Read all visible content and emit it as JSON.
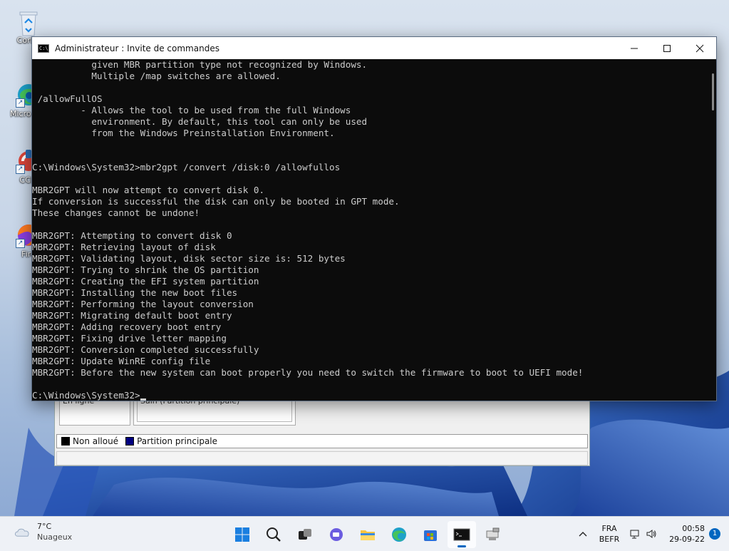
{
  "desktop": {
    "icons": [
      {
        "label": "Corbe",
        "icon": "recycle-bin-icon"
      },
      {
        "label": "Micro Edg",
        "icon": "edge-icon"
      },
      {
        "label": "CCle",
        "icon": "ccleaner-icon"
      },
      {
        "label": "Fire",
        "icon": "firefox-icon"
      }
    ]
  },
  "disk_management": {
    "disk_label": "En ligne",
    "partition_label": "Sain (Partition principale)",
    "legend": [
      {
        "label": "Non alloué",
        "color": "#000000"
      },
      {
        "label": "Partition principale",
        "color": "#000080"
      }
    ]
  },
  "cmd": {
    "title": "Administrateur : Invite de commandes",
    "lines": [
      "           given MBR partition type not recognized by Windows.",
      "           Multiple /map switches are allowed.",
      "",
      " /allowFullOS",
      "         - Allows the tool to be used from the full Windows",
      "           environment. By default, this tool can only be used",
      "           from the Windows Preinstallation Environment.",
      "",
      "",
      "C:\\Windows\\System32>mbr2gpt /convert /disk:0 /allowfullos",
      "",
      "MBR2GPT will now attempt to convert disk 0.",
      "If conversion is successful the disk can only be booted in GPT mode.",
      "These changes cannot be undone!",
      "",
      "MBR2GPT: Attempting to convert disk 0",
      "MBR2GPT: Retrieving layout of disk",
      "MBR2GPT: Validating layout, disk sector size is: 512 bytes",
      "MBR2GPT: Trying to shrink the OS partition",
      "MBR2GPT: Creating the EFI system partition",
      "MBR2GPT: Installing the new boot files",
      "MBR2GPT: Performing the layout conversion",
      "MBR2GPT: Migrating default boot entry",
      "MBR2GPT: Adding recovery boot entry",
      "MBR2GPT: Fixing drive letter mapping",
      "MBR2GPT: Conversion completed successfully",
      "MBR2GPT: Update WinRE config file",
      "MBR2GPT: Before the new system can boot properly you need to switch the firmware to boot to UEFI mode!",
      ""
    ],
    "prompt": "C:\\Windows\\System32>"
  },
  "taskbar": {
    "weather_temp": "7°C",
    "weather_desc": "Nuageux",
    "apps": [
      "start-icon",
      "search-icon",
      "task-view-icon",
      "chat-icon",
      "file-explorer-icon",
      "edge-icon",
      "store-icon",
      "terminal-icon",
      "network-drive-icon"
    ],
    "active_app": "terminal-icon",
    "lang_top": "FRA",
    "lang_bottom": "BEFR",
    "time": "00:58",
    "date": "29-09-22",
    "notification_count": "1"
  }
}
